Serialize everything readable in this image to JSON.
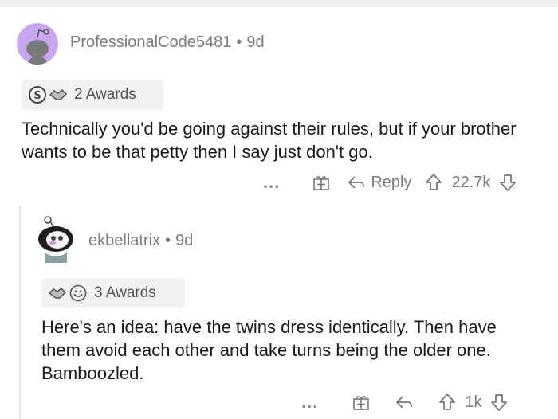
{
  "comment1": {
    "username": "ProfessionalCode5481",
    "separator": "•",
    "age": "9d",
    "awards_label": "2 Awards",
    "body": "Technically you'd be going against their rules, but if your brother wants to be that petty then I say just don't go.",
    "more": "...",
    "reply_label": "Reply",
    "score": "22.7k"
  },
  "comment2": {
    "username": "ekbellatrix",
    "separator": "•",
    "age": "9d",
    "awards_label": "3 Awards",
    "body": "Here's an idea: have the twins dress identically. Then have them avoid each other and take turns being the older one. Bamboozled.",
    "more": "...",
    "score": "1k"
  },
  "colors": {
    "avatar1_bg": "#c9a7f0",
    "meta_text": "#7c7c7c",
    "award_bg": "#f2f2f2"
  }
}
